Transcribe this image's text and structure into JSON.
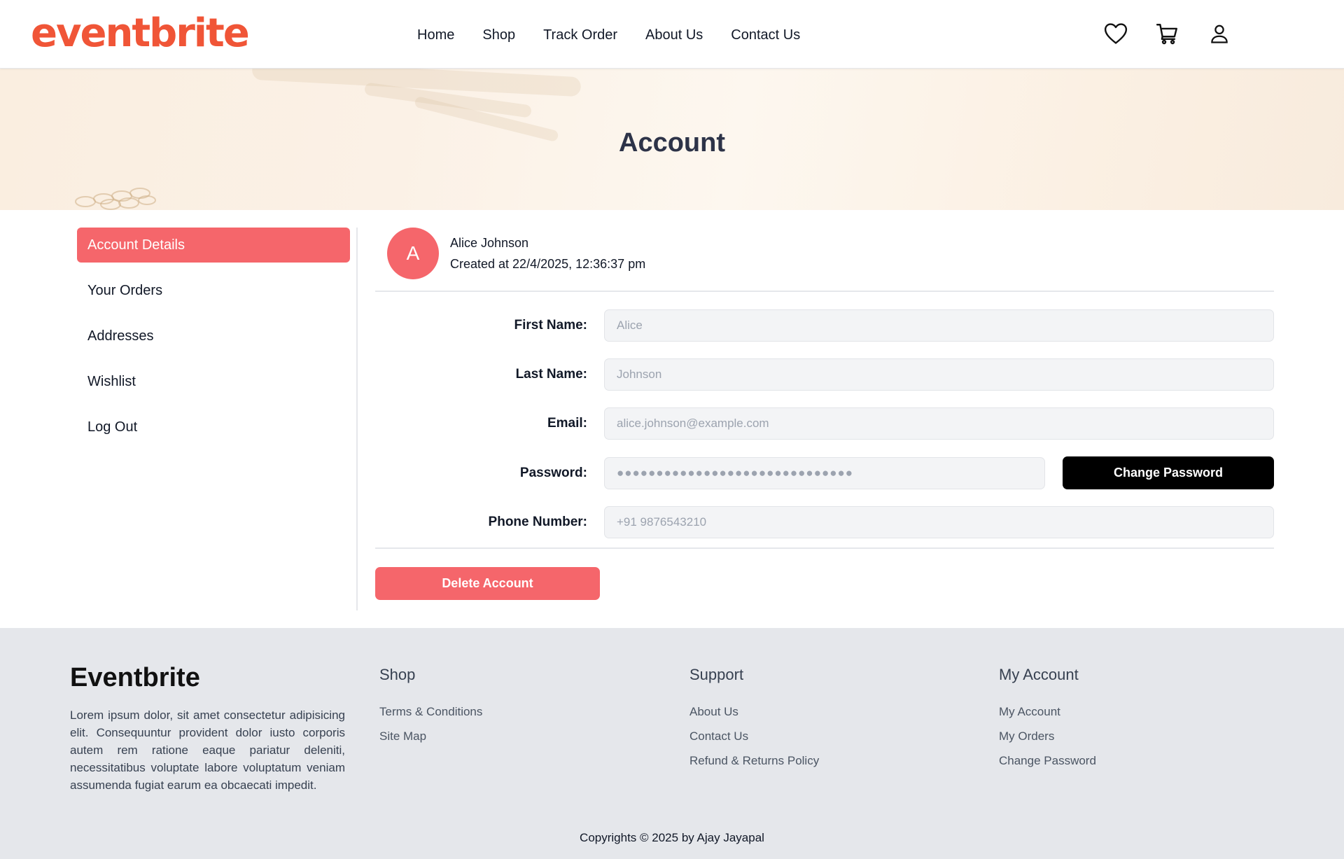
{
  "header": {
    "logo": "eventbrite",
    "nav": [
      "Home",
      "Shop",
      "Track Order",
      "About Us",
      "Contact Us"
    ],
    "icons": [
      "heart-icon",
      "cart-icon",
      "user-icon"
    ]
  },
  "hero": {
    "title": "Account"
  },
  "sidebar": {
    "items": [
      {
        "label": "Account Details",
        "active": true
      },
      {
        "label": "Your Orders"
      },
      {
        "label": "Addresses"
      },
      {
        "label": "Wishlist"
      },
      {
        "label": "Log Out"
      }
    ]
  },
  "profile": {
    "avatar_letter": "A",
    "name": "Alice Johnson",
    "created": "Created at 22/4/2025, 12:36:37 pm"
  },
  "form": {
    "first_name": {
      "label": "First Name:",
      "value": "Alice"
    },
    "last_name": {
      "label": "Last Name:",
      "value": "Johnson"
    },
    "email": {
      "label": "Email:",
      "value": "alice.johnson@example.com"
    },
    "password": {
      "label": "Password:",
      "value": "●●●●●●●●●●●●●●●●●●●●●●●●●●●●●●"
    },
    "phone": {
      "label": "Phone Number:",
      "value": "+91 9876543210"
    },
    "change_password_label": "Change Password",
    "delete_label": "Delete Account"
  },
  "footer": {
    "brand": "Eventbrite",
    "description": "Lorem ipsum dolor, sit amet consectetur adipisicing elit. Consequuntur provident dolor iusto corporis autem rem ratione eaque pariatur deleniti, necessitatibus voluptate labore voluptatum veniam assumenda fugiat earum ea obcaecati impedit.",
    "columns": [
      {
        "title": "Shop",
        "links": [
          "Terms & Conditions",
          "Site Map"
        ]
      },
      {
        "title": "Support",
        "links": [
          "About Us",
          "Contact Us",
          "Refund & Returns Policy"
        ]
      },
      {
        "title": "My Account",
        "links": [
          "My Account",
          "My Orders",
          "Change Password"
        ]
      }
    ],
    "copyright": "Copyrights © 2025 by Ajay Jayapal"
  },
  "colors": {
    "brand": "#f05537",
    "accent": "#f5666b",
    "dark": "#000000",
    "footer_bg": "#e5e7eb"
  }
}
